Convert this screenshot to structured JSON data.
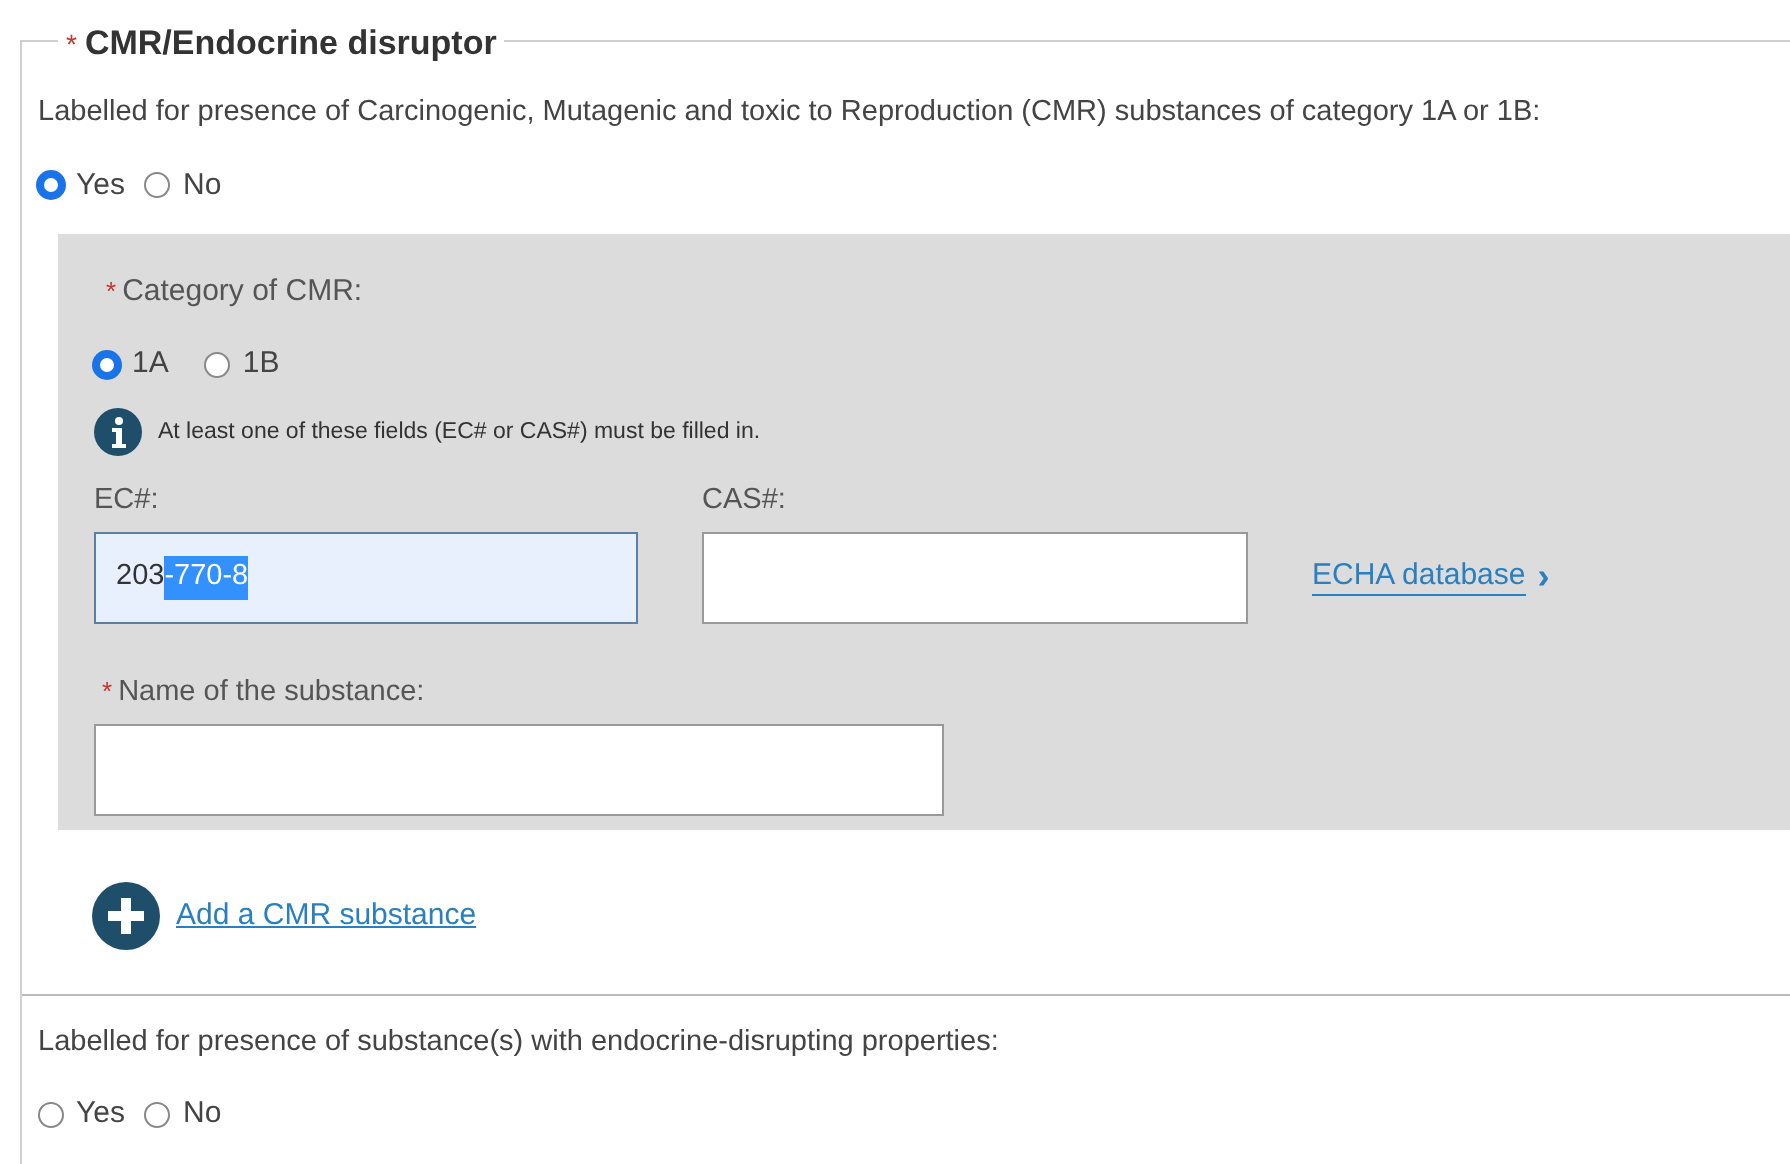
{
  "section": {
    "required_mark": "*",
    "title": "CMR/Endocrine disruptor"
  },
  "cmr_question": {
    "text": "Labelled for presence of Carcinogenic, Mutagenic and toxic to Reproduction (CMR) substances of category 1A or 1B:",
    "options": [
      {
        "label": "Yes",
        "selected": true
      },
      {
        "label": "No",
        "selected": false
      }
    ]
  },
  "cmr_panel": {
    "category": {
      "required_mark": "*",
      "label": "Category of CMR:",
      "options": [
        {
          "label": "1A",
          "selected": true
        },
        {
          "label": "1B",
          "selected": false
        }
      ]
    },
    "info": "At least one of these fields (EC# or CAS#) must be filled in.",
    "ec_field": {
      "label": "EC#:",
      "value": "203",
      "highlighted_value": "-770-8",
      "focused": true
    },
    "cas_field": {
      "label": "CAS#:",
      "focused": false
    },
    "link": {
      "label": "ECHA database",
      "arrow": "›"
    },
    "name_field": {
      "required_mark": "*",
      "label": "Name of the substance:",
      "focused": false
    }
  },
  "add_link": "Add a CMR substance",
  "endocrine_question": {
    "text": "Labelled for presence of substance(s) with endocrine-disrupting properties:",
    "options": [
      {
        "label": "Yes",
        "selected": false
      },
      {
        "label": "No",
        "selected": false
      }
    ]
  }
}
